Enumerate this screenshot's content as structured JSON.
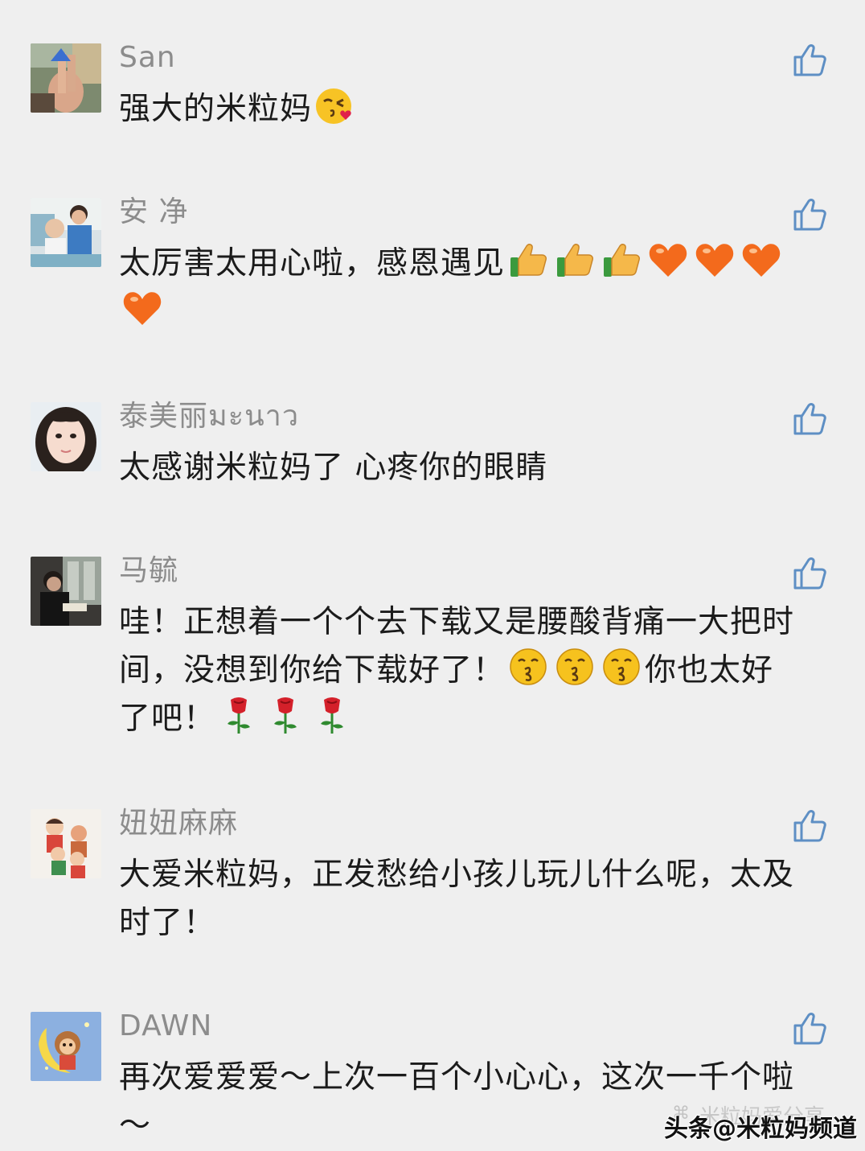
{
  "comments": [
    {
      "username": "San",
      "segments": [
        {
          "text": "强大的米粒妈"
        },
        {
          "emoji": "kiss-heart-face"
        }
      ]
    },
    {
      "username": "安 净",
      "segments": [
        {
          "text": "太厉害太用心啦，感恩遇见"
        },
        {
          "emoji": "thumbs-up"
        },
        {
          "emoji": "thumbs-up"
        },
        {
          "emoji": "thumbs-up"
        },
        {
          "emoji": "orange-heart"
        },
        {
          "emoji": "orange-heart"
        },
        {
          "emoji": "orange-heart"
        },
        {
          "emoji": "orange-heart"
        }
      ]
    },
    {
      "username": "泰美丽มะนาว",
      "segments": [
        {
          "text": "太感谢米粒妈了 心疼你的眼睛"
        }
      ]
    },
    {
      "username": "马毓",
      "segments": [
        {
          "text": "哇！正想着一个个去下载又是腰酸背痛一大把时间，没想到你给下载好了！"
        },
        {
          "emoji": "kissing-face"
        },
        {
          "emoji": "kissing-face"
        },
        {
          "emoji": "kissing-face"
        },
        {
          "text": "你也太好了吧！"
        },
        {
          "emoji": "rose"
        },
        {
          "emoji": "rose"
        },
        {
          "emoji": "rose"
        }
      ]
    },
    {
      "username": "妞妞麻麻",
      "segments": [
        {
          "text": "大爱米粒妈，正发愁给小孩儿玩儿什么呢，太及时了！"
        }
      ]
    },
    {
      "username": "DAWN",
      "segments": [
        {
          "text": "再次爱爱爱～上次一百个小心心，这次一千个啦～"
        }
      ]
    }
  ],
  "watermark": {
    "ghost_text": "米粒妈爱分享",
    "main_text": "头条@米粒妈频道"
  },
  "colors": {
    "background": "#efefef",
    "username": "#8c8c8c",
    "content": "#1b1b1b",
    "like_icon": "#5e8fc4"
  }
}
